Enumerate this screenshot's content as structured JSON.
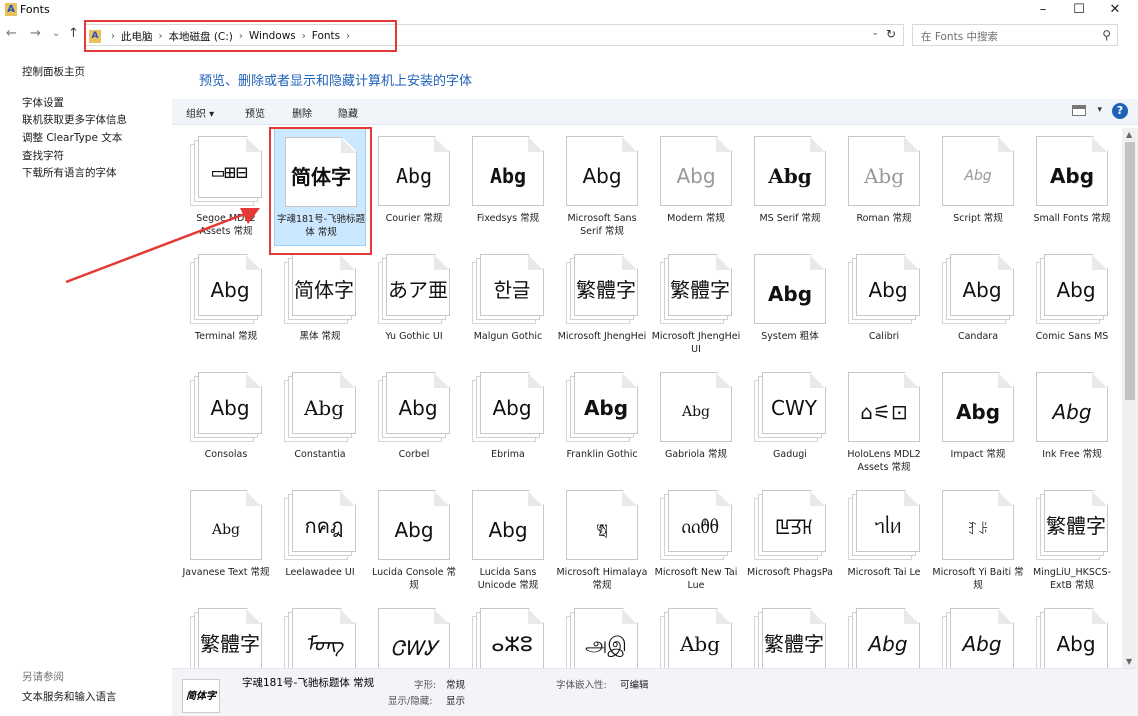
{
  "window": {
    "title": "Fonts",
    "app_icon_letter": "A",
    "minimize": "–",
    "maximize": "☐",
    "close": "✕"
  },
  "nav": {
    "back": "←",
    "forward": "→",
    "recent": "⌄",
    "up": "↑"
  },
  "address": {
    "crumbs": [
      "此电脑",
      "本地磁盘 (C:)",
      "Windows",
      "Fonts"
    ],
    "sep": "›",
    "end_sep": "›",
    "dropdown": "⌄",
    "refresh": "↻"
  },
  "search": {
    "placeholder": "在 Fonts 中搜索",
    "icon": "⚲"
  },
  "left": {
    "home": "控制面板主页",
    "links": [
      "字体设置",
      "联机获取更多字体信息",
      "调整 ClearType 文本",
      "查找字符",
      "下载所有语言的字体"
    ],
    "see_also": "另请参阅",
    "see_also_link": "文本服务和输入语言"
  },
  "heading": "预览、删除或者显示和隐藏计算机上安装的字体",
  "toolbar": {
    "organize": "组织 ▾",
    "preview": "预览",
    "delete": "删除",
    "hide": "隐藏",
    "view_drop": "▾",
    "help": "?"
  },
  "fonts": [
    {
      "sample": "▭⊞⊟",
      "name": "Segoe MDL2 Assets 常规",
      "stack": true
    },
    {
      "sample": "简体字",
      "name": "字魂181号-飞驰标题体 常规",
      "stack": false,
      "selected": true
    },
    {
      "sample": "Abg",
      "name": "Courier 常规",
      "stack": false
    },
    {
      "sample": "Abg",
      "name": "Fixedsys 常规",
      "stack": false
    },
    {
      "sample": "Abg",
      "name": "Microsoft Sans Serif 常规",
      "stack": false
    },
    {
      "sample": "Abg",
      "name": "Modern 常规",
      "stack": false
    },
    {
      "sample": "Abg",
      "name": "MS Serif 常规",
      "stack": false
    },
    {
      "sample": "Abg",
      "name": "Roman 常规",
      "stack": false
    },
    {
      "sample": "Abg",
      "name": "Script 常规",
      "stack": false
    },
    {
      "sample": "Abg",
      "name": "Small Fonts 常规",
      "stack": false
    },
    {
      "sample": "Abg",
      "name": "Terminal 常规",
      "stack": true
    },
    {
      "sample": "简体字",
      "name": "黑体 常规",
      "stack": true
    },
    {
      "sample": "あア亜",
      "name": "Yu Gothic UI",
      "stack": true
    },
    {
      "sample": "한글",
      "name": "Malgun Gothic",
      "stack": true
    },
    {
      "sample": "繁體字",
      "name": "Microsoft JhengHei",
      "stack": true
    },
    {
      "sample": "繁體字",
      "name": "Microsoft JhengHei UI",
      "stack": true
    },
    {
      "sample": "Abg",
      "name": "System 粗体",
      "stack": false
    },
    {
      "sample": "Abg",
      "name": "Calibri",
      "stack": true
    },
    {
      "sample": "Abg",
      "name": "Candara",
      "stack": true
    },
    {
      "sample": "Abg",
      "name": "Comic Sans MS",
      "stack": true
    },
    {
      "sample": "Abg",
      "name": "Consolas",
      "stack": true
    },
    {
      "sample": "Abg",
      "name": "Constantia",
      "stack": true
    },
    {
      "sample": "Abg",
      "name": "Corbel",
      "stack": true
    },
    {
      "sample": "Abg",
      "name": "Ebrima",
      "stack": true
    },
    {
      "sample": "Abg",
      "name": "Franklin Gothic",
      "stack": true
    },
    {
      "sample": "Abg",
      "name": "Gabriola 常规",
      "stack": false
    },
    {
      "sample": "CWY",
      "name": "Gadugi",
      "stack": true
    },
    {
      "sample": "⌂⚟⊡",
      "name": "HoloLens MDL2 Assets 常规",
      "stack": false
    },
    {
      "sample": "Abg",
      "name": "Impact 常规",
      "stack": false
    },
    {
      "sample": "Abg",
      "name": "Ink Free 常规",
      "stack": false
    },
    {
      "sample": "Abg",
      "name": "Javanese Text 常规",
      "stack": false
    },
    {
      "sample": "กคฎ",
      "name": "Leelawadee UI",
      "stack": true
    },
    {
      "sample": "Abg",
      "name": "Lucida Console 常规",
      "stack": false
    },
    {
      "sample": "Abg",
      "name": "Lucida Sans Unicode 常规",
      "stack": false
    },
    {
      "sample": "ཨྥ",
      "name": "Microsoft Himalaya 常规",
      "stack": false
    },
    {
      "sample": "ᦶᦹᦲ",
      "name": "Microsoft New Tai Lue",
      "stack": true
    },
    {
      "sample": "ꡖꡗꡘ",
      "name": "Microsoft PhagsPa",
      "stack": true
    },
    {
      "sample": "ᥐᥣᥢ",
      "name": "Microsoft Tai Le",
      "stack": true
    },
    {
      "sample": "ꆈꌠ",
      "name": "Microsoft Yi Baiti 常规",
      "stack": false
    },
    {
      "sample": "繁體字",
      "name": "MingLiU_HKSCS-ExtB 常规",
      "stack": true
    },
    {
      "sample": "繁體字",
      "name": "",
      "stack": true
    },
    {
      "sample": "ᠮᠣᠩ",
      "name": "",
      "stack": true
    },
    {
      "sample": "ᏣᎳᎩ",
      "name": "",
      "stack": false
    },
    {
      "sample": "ⴰⵣⵓ",
      "name": "",
      "stack": true
    },
    {
      "sample": "அஇ",
      "name": "",
      "stack": true
    },
    {
      "sample": "Abg",
      "name": "",
      "stack": true
    },
    {
      "sample": "繁體字",
      "name": "",
      "stack": true
    },
    {
      "sample": "Abg",
      "name": "",
      "stack": true
    },
    {
      "sample": "Abg",
      "name": "",
      "stack": true
    },
    {
      "sample": "Abg",
      "name": "",
      "stack": true
    }
  ],
  "details": {
    "thumb": "简体字",
    "name": "字魂181号-飞驰标题体 常规",
    "style_label": "字形:",
    "style_value": "常规",
    "show_label": "显示/隐藏:",
    "show_value": "显示",
    "embed_label": "字体嵌入性:",
    "embed_value": "可编辑"
  },
  "colors": {
    "accent": "#1e62b8",
    "selection": "#cce8ff",
    "annotation": "#e53935"
  }
}
